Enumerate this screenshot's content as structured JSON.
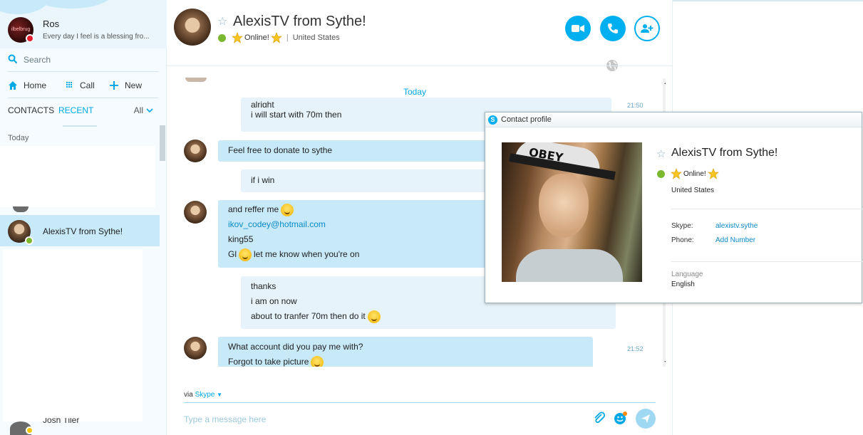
{
  "sidebar": {
    "profile": {
      "name": "Ros",
      "mood": "Every day I feel is a blessing fro...",
      "avatar_text": "ilbelbrug"
    },
    "search_placeholder": "Search",
    "nav": {
      "home": "Home",
      "call": "Call",
      "new": "New"
    },
    "tabs": {
      "contacts": "CONTACTS",
      "recent": "RECENT",
      "filter": "All"
    },
    "section_today": "Today",
    "selected_contact": "AlexisTV from Sythe!",
    "partial_contact": "Josh Tiler"
  },
  "chat": {
    "title": "AlexisTV from Sythe!",
    "mood": "Online!",
    "location": "United States",
    "date_label": "Today",
    "messages": [
      {
        "lines": [
          "alright",
          "i will start with 70m then"
        ],
        "time": "21:50"
      },
      {
        "lines": [
          "Feel free to donate to sythe"
        ]
      },
      {
        "lines": [
          "if i win"
        ]
      },
      {
        "lines": [
          "and reffer me",
          "ikov_codey@hotmail.com",
          "king55",
          "Gl",
          "let me know when you're on"
        ]
      },
      {
        "lines": [
          "thanks",
          "i am on now",
          "about to tranfer 70m then do it"
        ]
      },
      {
        "lines": [
          "What account did you pay me with?",
          "Forgot to take picture"
        ],
        "time": "21:52"
      }
    ],
    "via_label": "via",
    "via_service": "Skype",
    "compose_placeholder": "Type a message here"
  },
  "profile_popup": {
    "window_title": "Contact profile",
    "name": "AlexisTV from Sythe!",
    "mood": "Online!",
    "location": "United States",
    "skype_label": "Skype:",
    "skype_value": "alexistv.sythe",
    "phone_label": "Phone:",
    "phone_value": "Add Number",
    "language_label": "Language",
    "language_value": "English",
    "photo_text": "OBEY"
  },
  "colors": {
    "accent": "#00aff0",
    "bubble": "#c7e9f8",
    "online": "#7cb82f",
    "busy": "#e81e2e"
  }
}
